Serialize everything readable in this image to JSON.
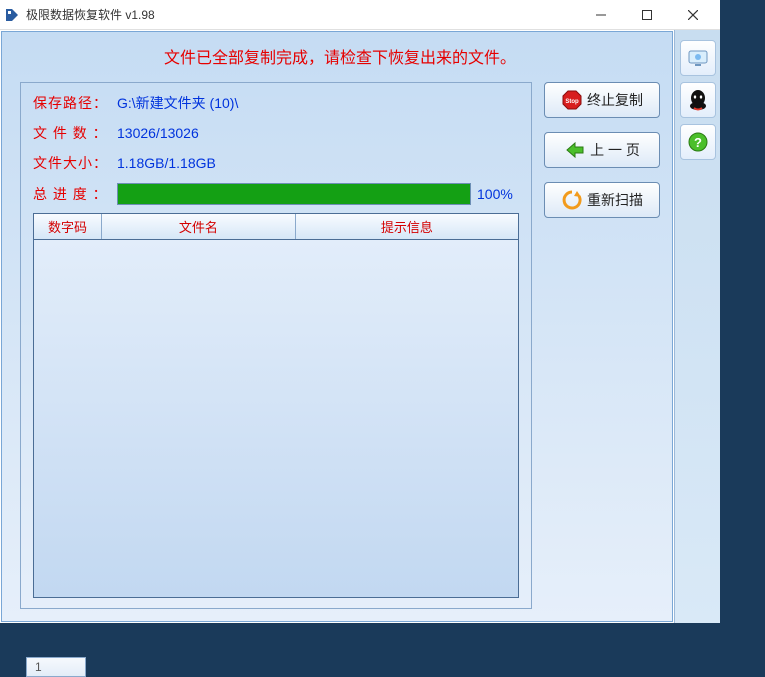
{
  "window": {
    "title": "极限数据恢复软件 v1.98"
  },
  "status_message": "文件已全部复制完成，请检查下恢复出来的文件。",
  "info": {
    "save_path_label": "保存路径：",
    "save_path_value": "G:\\新建文件夹 (10)\\",
    "file_count_label": "文 件 数 ：",
    "file_count_value": "13026/13026",
    "file_size_label": "文件大小：",
    "file_size_value": "1.18GB/1.18GB",
    "progress_label": "总 进 度 ：",
    "progress_pct": "100%"
  },
  "table": {
    "col1": "数字码",
    "col2": "文件名",
    "col3": "提示信息"
  },
  "buttons": {
    "stop": "终止复制",
    "prev": "上 一 页",
    "rescan": "重新扫描"
  },
  "footer_tab": "1"
}
